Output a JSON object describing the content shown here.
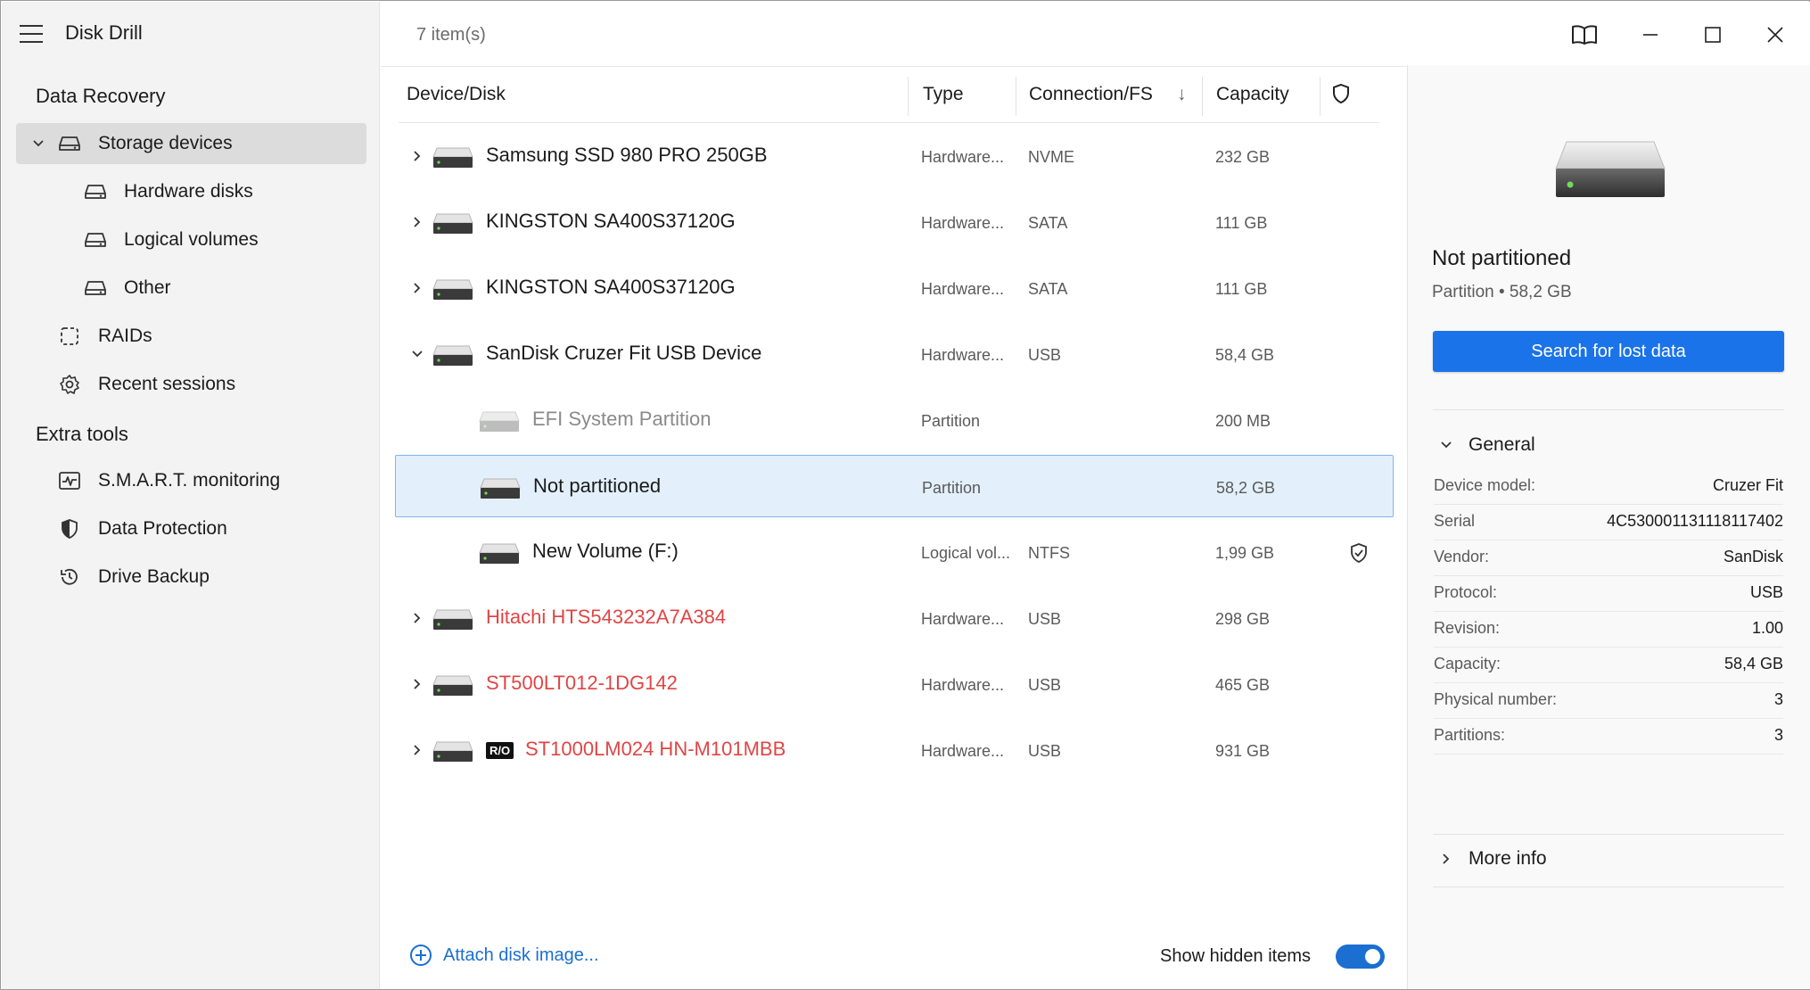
{
  "sidebar": {
    "app_title": "Disk Drill",
    "section_data_recovery": "Data Recovery",
    "storage_devices": "Storage devices",
    "hardware_disks": "Hardware disks",
    "logical_volumes": "Logical volumes",
    "other": "Other",
    "raids": "RAIDs",
    "recent_sessions": "Recent sessions",
    "section_extra_tools": "Extra tools",
    "smart_monitoring": "S.M.A.R.T. monitoring",
    "data_protection": "Data Protection",
    "drive_backup": "Drive Backup"
  },
  "main": {
    "items_count": "7 item(s)",
    "columns": {
      "device": "Device/Disk",
      "type": "Type",
      "connection": "Connection/FS",
      "sort_indicator": "↓",
      "capacity": "Capacity"
    },
    "rows": [
      {
        "name": "Samsung SSD 980 PRO 250GB",
        "type": "Hardware...",
        "conn": "NVME",
        "capacity": "232 GB",
        "expander": "collapsed",
        "status": "normal"
      },
      {
        "name": "KINGSTON SA400S37120G",
        "type": "Hardware...",
        "conn": "SATA",
        "capacity": "111 GB",
        "expander": "collapsed",
        "status": "normal"
      },
      {
        "name": "KINGSTON SA400S37120G",
        "type": "Hardware...",
        "conn": "SATA",
        "capacity": "111 GB",
        "expander": "collapsed",
        "status": "normal"
      },
      {
        "name": "SanDisk Cruzer Fit USB Device",
        "type": "Hardware...",
        "conn": "USB",
        "capacity": "58,4 GB",
        "expander": "expanded",
        "status": "normal"
      },
      {
        "name": "EFI System Partition",
        "type": "Partition",
        "conn": "",
        "capacity": "200 MB",
        "expander": "none",
        "status": "dimmed"
      },
      {
        "name": "Not partitioned",
        "type": "Partition",
        "conn": "",
        "capacity": "58,2 GB",
        "expander": "none",
        "status": "selected"
      },
      {
        "name": "New Volume (F:)",
        "type": "Logical vol...",
        "conn": "NTFS",
        "capacity": "1,99 GB",
        "expander": "none",
        "status": "protected"
      },
      {
        "name": "Hitachi HTS543232A7A384",
        "type": "Hardware...",
        "conn": "USB",
        "capacity": "298 GB",
        "expander": "collapsed",
        "status": "warning"
      },
      {
        "name": "ST500LT012-1DG142",
        "type": "Hardware...",
        "conn": "USB",
        "capacity": "465 GB",
        "expander": "collapsed",
        "status": "warning"
      },
      {
        "name": "ST1000LM024 HN-M101MBB",
        "type": "Hardware...",
        "conn": "USB",
        "capacity": "931 GB",
        "expander": "collapsed",
        "status": "warning",
        "badge": "R/O"
      }
    ],
    "attach_label": "Attach disk image...",
    "show_hidden_label": "Show hidden items",
    "show_hidden_on": true
  },
  "details": {
    "title": "Not partitioned",
    "subtitle": "Partition • 58,2 GB",
    "search_button": "Search for lost data",
    "general_label": "General",
    "properties": [
      {
        "key": "Device model:",
        "value": "Cruzer Fit"
      },
      {
        "key": "Serial",
        "value": "4C530001131118117402"
      },
      {
        "key": "Vendor:",
        "value": "SanDisk"
      },
      {
        "key": "Protocol:",
        "value": "USB"
      },
      {
        "key": "Revision:",
        "value": "1.00"
      },
      {
        "key": "Capacity:",
        "value": "58,4 GB"
      },
      {
        "key": "Physical number:",
        "value": "3"
      },
      {
        "key": "Partitions:",
        "value": "3"
      }
    ],
    "more_info": "More info"
  },
  "colors": {
    "accent": "#1a73e8",
    "link": "#1a6fd1",
    "warning_text": "#e04545",
    "selected_row": "#e3f0fb"
  }
}
